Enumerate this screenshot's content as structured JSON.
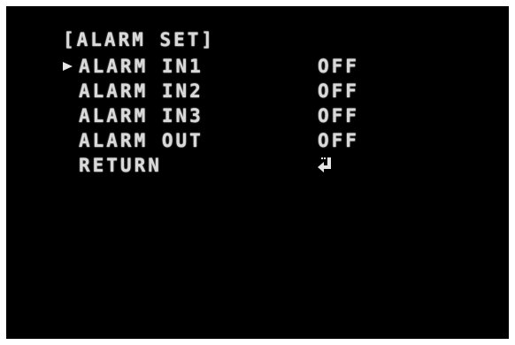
{
  "menu": {
    "title": "[ALARM SET]",
    "items": [
      {
        "label": "ALARM IN1",
        "value": "OFF",
        "selected": true
      },
      {
        "label": "ALARM IN2",
        "value": "OFF",
        "selected": false
      },
      {
        "label": "ALARM IN3",
        "value": "OFF",
        "selected": false
      },
      {
        "label": "ALARM OUT",
        "value": "OFF",
        "selected": false
      },
      {
        "label": "RETURN",
        "icon": "enter-return-icon"
      }
    ]
  },
  "colors": {
    "background": "#000000",
    "text": "#d9d9d9",
    "frame": "#ffffff"
  }
}
